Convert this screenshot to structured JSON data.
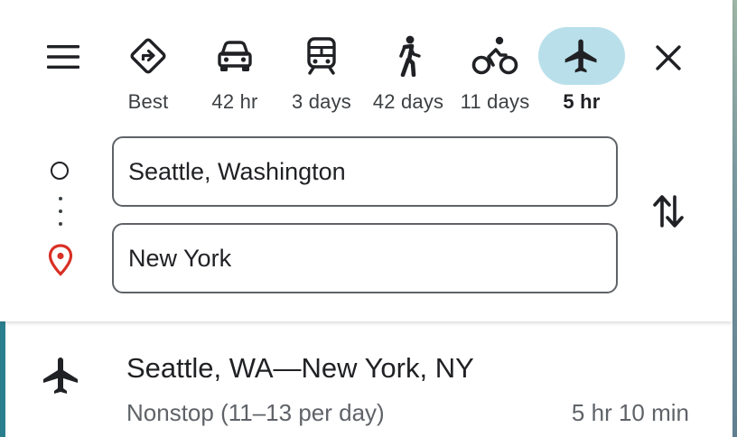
{
  "menu": {
    "icon": "hamburger-menu-icon"
  },
  "travel_modes": [
    {
      "id": "best",
      "icon": "directions-diamond-icon",
      "label": "Best",
      "active": false
    },
    {
      "id": "driving",
      "icon": "car-icon",
      "label": "42 hr",
      "active": false
    },
    {
      "id": "transit",
      "icon": "train-icon",
      "label": "3 days",
      "active": false
    },
    {
      "id": "walking",
      "icon": "walking-person-icon",
      "label": "42 days",
      "active": false
    },
    {
      "id": "cycling",
      "icon": "bicycle-icon",
      "label": "11 days",
      "active": false
    },
    {
      "id": "flights",
      "icon": "airplane-icon",
      "label": "5 hr",
      "active": true
    }
  ],
  "close": {
    "icon": "close-icon"
  },
  "route": {
    "origin": "Seattle, Washington",
    "destination": "New York",
    "swap_icon": "swap-arrows-icon"
  },
  "result": {
    "icon": "airplane-icon",
    "title": "Seattle, WA—New York, NY",
    "subtitle": "Nonstop (11–13 per day)",
    "duration": "5 hr 10 min"
  },
  "colors": {
    "active_mode_bg": "#b9e0ea",
    "pin_red": "#d93025",
    "result_accent": "#2a7f8f",
    "text_primary": "#202124",
    "text_secondary": "#5f6368"
  }
}
